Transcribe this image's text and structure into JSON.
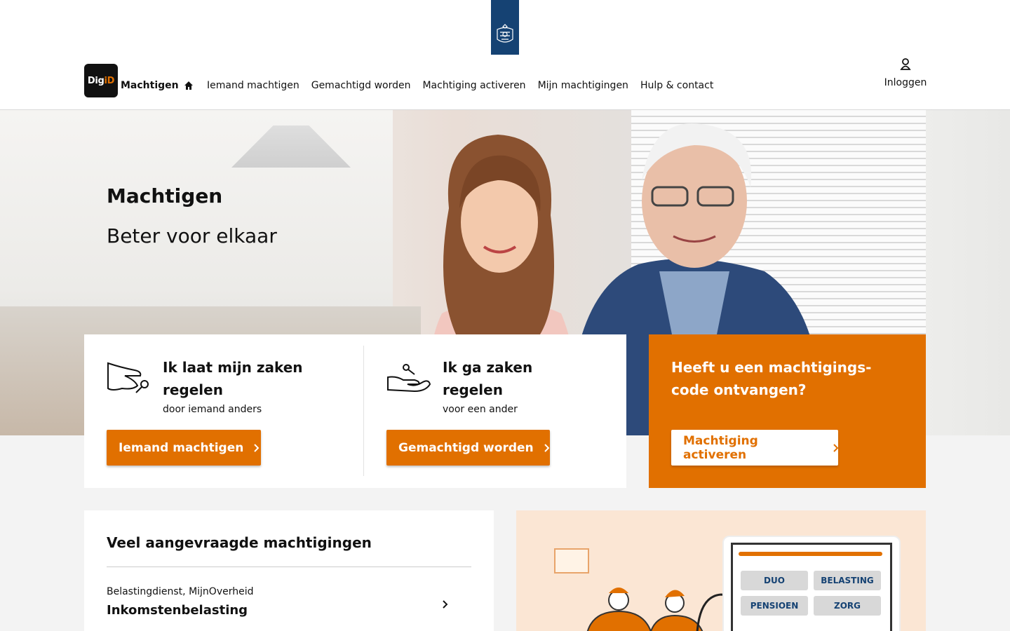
{
  "header": {
    "brand": "Machtigen",
    "logo": {
      "part1": "Dig",
      "part2": "iD"
    },
    "nav": [
      "Iemand machtigen",
      "Gemachtigd worden",
      "Machtiging activeren",
      "Mijn machtigingen",
      "Hulp & contact"
    ],
    "login_label": "Inloggen",
    "icons": {
      "home": "home-icon",
      "user": "user-icon",
      "crest": "crest-icon"
    }
  },
  "hero": {
    "title": "Machtigen",
    "subtitle": "Beter voor elkaar"
  },
  "cards": {
    "give": {
      "title_line1": "Ik laat mijn zaken",
      "title_line2": "regelen",
      "subtitle": "door iemand anders",
      "button": "Iemand machtigen"
    },
    "receive": {
      "title_line1": "Ik ga zaken",
      "title_line2": "regelen",
      "subtitle": "voor een ander",
      "button": "Gemachtigd worden"
    },
    "activate": {
      "title_line1": "Heeft u een machtigings-",
      "title_line2": "code ontvangen?",
      "button": "Machtiging activeren"
    }
  },
  "popular": {
    "title": "Veel aangevraagde machtigingen",
    "items": [
      {
        "org": "Belastingdienst, MijnOverheid",
        "name": "Inkomstenbelasting"
      }
    ]
  },
  "illustration": {
    "tiles": [
      "DUO",
      "BELASTING",
      "PENSIOEN",
      "ZORG"
    ]
  },
  "colors": {
    "accent": "#e17000",
    "crest_blue": "#154273"
  }
}
